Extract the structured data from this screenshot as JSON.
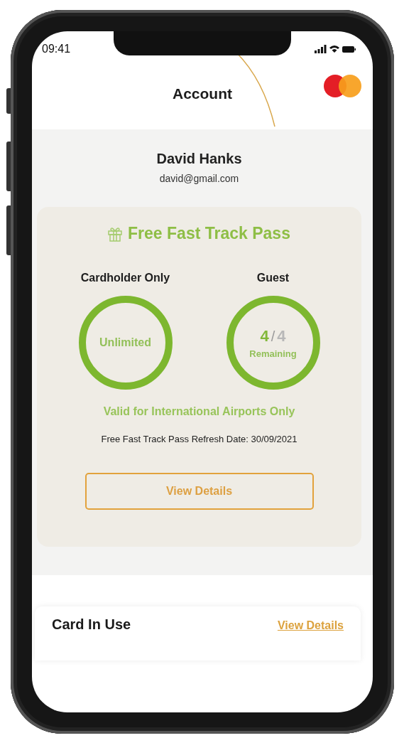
{
  "status_bar": {
    "time": "09:41"
  },
  "header": {
    "title": "Account"
  },
  "profile": {
    "name": "David Hanks",
    "email": "david@gmail.com"
  },
  "pass_card": {
    "title": "Free Fast Track Pass",
    "passes": [
      {
        "kind": "unlimited",
        "label": "Cardholder Only",
        "value": "Unlimited"
      },
      {
        "kind": "count",
        "label": "Guest",
        "count": "4",
        "separator": "/",
        "total": "4",
        "caption": "Remaining"
      }
    ],
    "note": "Valid for International Airports Only",
    "refresh": "Free Fast Track Pass Refresh Date: 30/09/2021",
    "button": "View Details"
  },
  "card_in_use": {
    "title": "Card In Use",
    "link": "View Details"
  }
}
